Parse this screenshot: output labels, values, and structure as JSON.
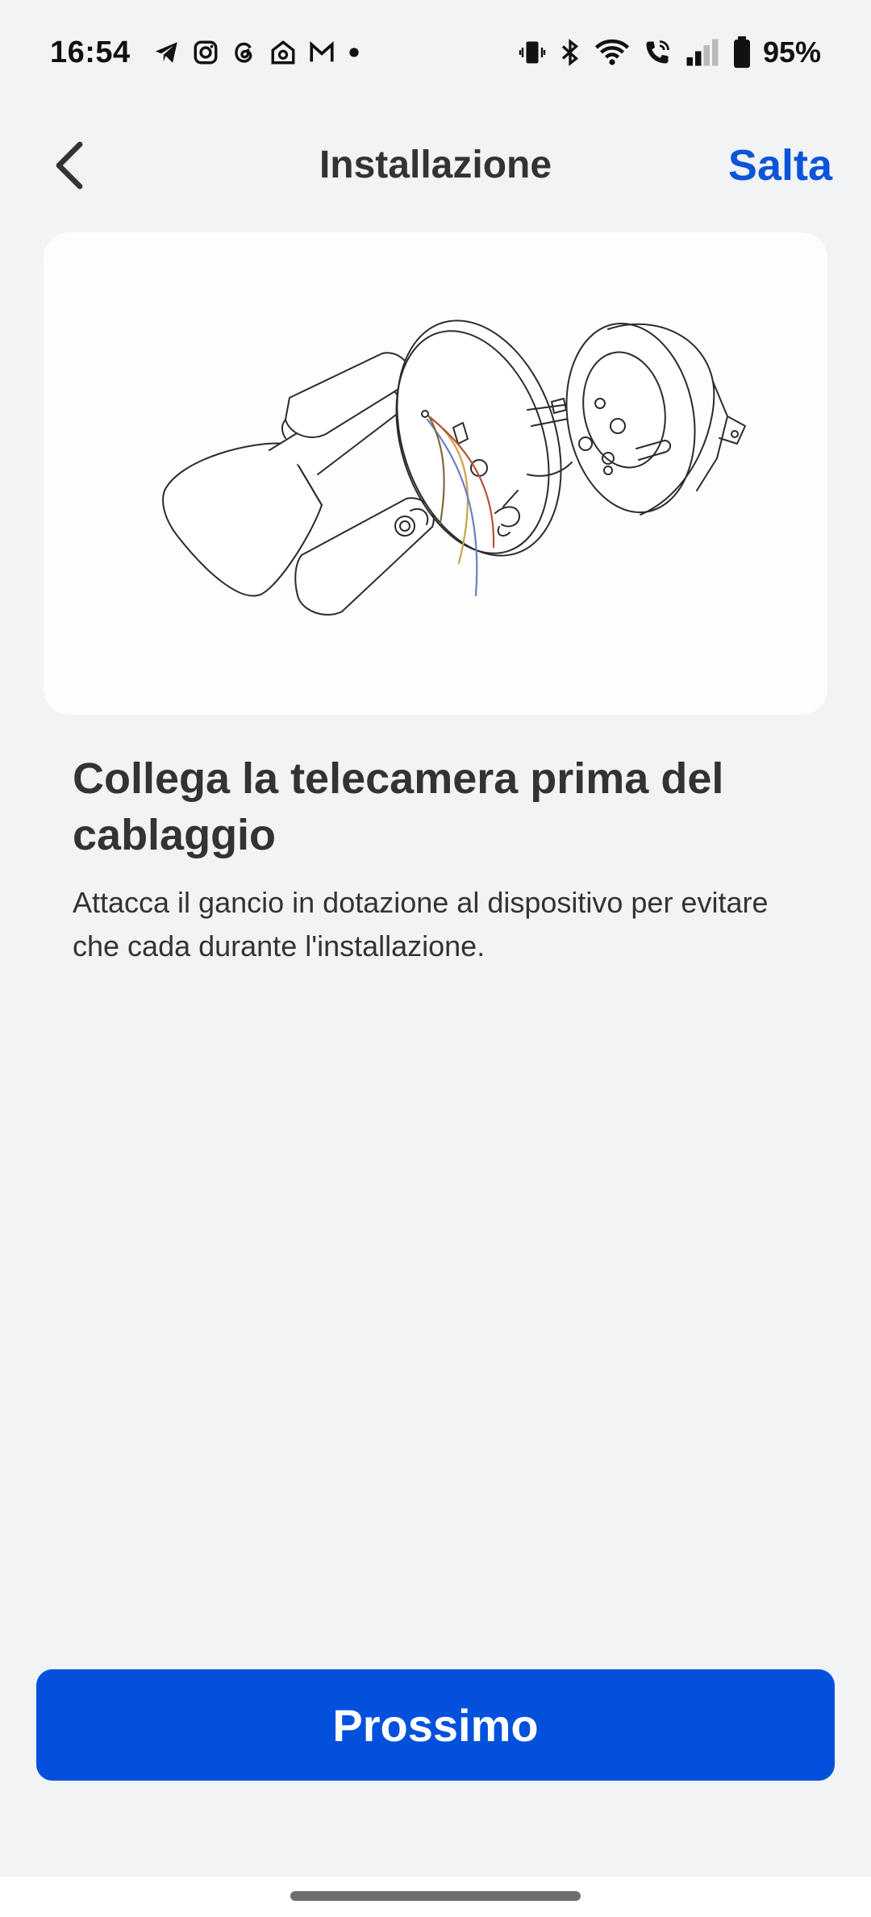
{
  "status_bar": {
    "time": "16:54",
    "left_icons": [
      "telegram-icon",
      "instagram-icon",
      "threads-icon",
      "home-app-icon",
      "gmail-icon",
      "dot-icon"
    ],
    "right_icons": [
      "vibrate-icon",
      "bluetooth-icon",
      "wifi-icon",
      "wifi-call-icon",
      "signal-icon",
      "battery-icon"
    ],
    "battery": "95%"
  },
  "header": {
    "title": "Installazione",
    "skip_label": "Salta",
    "back_icon": "chevron-left-icon"
  },
  "illustration": {
    "name": "floodlight-camera-wiring-illustration",
    "wire_colors": [
      "#c9a24a",
      "#6d7ec6",
      "#b5523a"
    ]
  },
  "content": {
    "title": "Collega la telecamera prima del cablaggio",
    "description": "Attacca il gancio in dotazione al dispositivo per evitare che cada durante l'installazione."
  },
  "actions": {
    "next_label": "Prossimo"
  },
  "colors": {
    "accent": "#0350dc",
    "link": "#0a55d8",
    "background": "#f2f3f5",
    "card": "#fdfdfd"
  }
}
